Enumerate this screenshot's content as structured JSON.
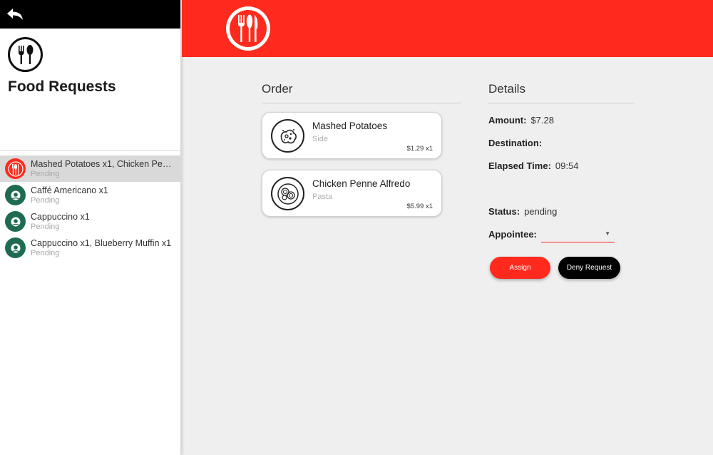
{
  "sidebar": {
    "title": "Food Requests",
    "requests": [
      {
        "title": "Mashed Potatoes x1, Chicken Penne ...",
        "status": "Pending",
        "avatar": "restaurant-red-logo",
        "selected": true
      },
      {
        "title": "Caffé Americano x1",
        "status": "Pending",
        "avatar": "coffee-green-logo"
      },
      {
        "title": "Cappuccino x1",
        "status": "Pending",
        "avatar": "coffee-green-logo"
      },
      {
        "title": "Cappuccino x1, Blueberry Muffin x1",
        "status": "Pending",
        "avatar": "coffee-green-logo"
      }
    ]
  },
  "colors": {
    "accent": "#ff2a1d",
    "coffee_green": "#1e6b52",
    "dark": "#000000"
  },
  "order": {
    "title": "Order",
    "items": [
      {
        "name": "Mashed Potatoes",
        "category": "Side",
        "price": "$1.29 x1",
        "icon": "mashed-potatoes-icon"
      },
      {
        "name": "Chicken Penne Alfredo",
        "category": "Pasta",
        "price": "$5.99 x1",
        "icon": "pasta-icon"
      }
    ]
  },
  "details": {
    "title": "Details",
    "amount_label": "Amount:",
    "amount": "$7.28",
    "destination_label": "Destination:",
    "destination": "",
    "elapsed_label": "Elapsed Time:",
    "elapsed": "09:54",
    "status_label": "Status:",
    "status": "pending",
    "appointee_label": "Appointee:",
    "appointee": "",
    "assign_label": "Assign",
    "deny_label": "Deny Request"
  }
}
